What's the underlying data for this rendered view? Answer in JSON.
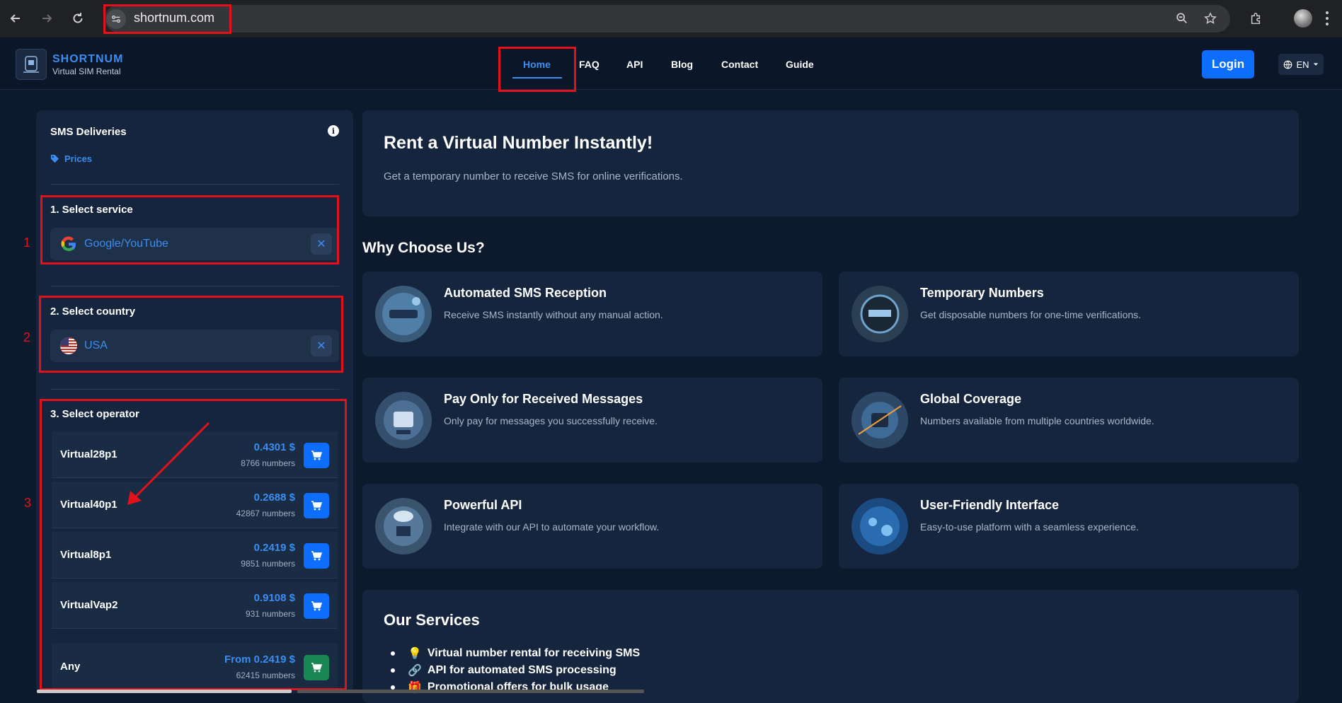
{
  "browser": {
    "url": "shortnum.com"
  },
  "header": {
    "brand_name": "SHORTNUM",
    "brand_sub": "Virtual SIM Rental",
    "nav": [
      "Home",
      "FAQ",
      "API",
      "Blog",
      "Contact",
      "Guide"
    ],
    "active_nav": "Home",
    "login_label": "Login",
    "lang_label": "EN"
  },
  "sidebar": {
    "title": "SMS Deliveries",
    "prices_label": "Prices",
    "step1_title": "1. Select service",
    "service_value": "Google/YouTube",
    "step2_title": "2. Select country",
    "country_value": "USA",
    "step3_title": "3. Select operator",
    "operators": [
      {
        "name": "Virtual28p1",
        "price": "0.4301 $",
        "count": "8766 numbers"
      },
      {
        "name": "Virtual40p1",
        "price": "0.2688 $",
        "count": "42867 numbers"
      },
      {
        "name": "Virtual8p1",
        "price": "0.2419 $",
        "count": "9851 numbers"
      },
      {
        "name": "VirtualVap2",
        "price": "0.9108 $",
        "count": "931 numbers"
      }
    ],
    "any": {
      "name": "Any",
      "price": "From 0.2419 $",
      "count": "62415 numbers"
    },
    "clear_symbol": "✕"
  },
  "annotations": [
    "1",
    "2",
    "3"
  ],
  "hero": {
    "title": "Rent a Virtual Number Instantly!",
    "subtitle": "Get a temporary number to receive SMS for online verifications."
  },
  "why": {
    "title": "Why Choose Us?",
    "features": [
      {
        "title": "Automated SMS Reception",
        "desc": "Receive SMS instantly without any manual action."
      },
      {
        "title": "Temporary Numbers",
        "desc": "Get disposable numbers for one-time verifications."
      },
      {
        "title": "Pay Only for Received Messages",
        "desc": "Only pay for messages you successfully receive."
      },
      {
        "title": "Global Coverage",
        "desc": "Numbers available from multiple countries worldwide."
      },
      {
        "title": "Powerful API",
        "desc": "Integrate with our API to automate your workflow."
      },
      {
        "title": "User-Friendly Interface",
        "desc": "Easy-to-use platform with a seamless experience."
      }
    ]
  },
  "services": {
    "title": "Our Services",
    "items": [
      {
        "icon": "💡",
        "text": "Virtual number rental for receiving SMS"
      },
      {
        "icon": "🔗",
        "text": "API for automated SMS processing"
      },
      {
        "icon": "🎁",
        "text": "Promotional offers for bulk usage"
      }
    ]
  },
  "colors": {
    "accent": "#3b8df0",
    "primary_button": "#0d6efd",
    "success_button": "#198754",
    "annotation_red": "#e3111b"
  }
}
